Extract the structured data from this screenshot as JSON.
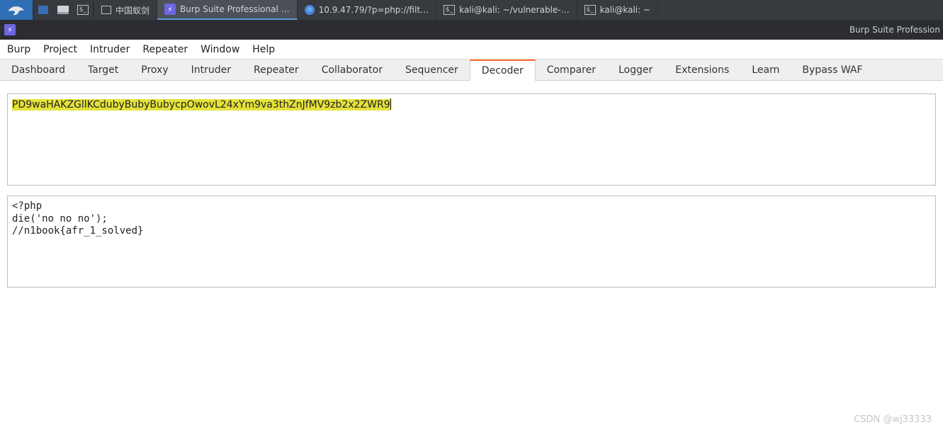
{
  "taskbar": {
    "items": [
      {
        "icon": "antsword",
        "label": "中国蚁剑"
      },
      {
        "icon": "burp",
        "label": "Burp Suite Professional …"
      },
      {
        "icon": "chromium",
        "label": "10.9.47.79/?p=php://filt…"
      },
      {
        "icon": "terminal",
        "label": "kali@kali: ~/vulnerable-…"
      },
      {
        "icon": "terminal",
        "label": "kali@kali: ~"
      }
    ]
  },
  "titlebar": {
    "title": "Burp Suite Profession"
  },
  "menu": [
    "Burp",
    "Project",
    "Intruder",
    "Repeater",
    "Window",
    "Help"
  ],
  "tabs": [
    "Dashboard",
    "Target",
    "Proxy",
    "Intruder",
    "Repeater",
    "Collaborator",
    "Sequencer",
    "Decoder",
    "Comparer",
    "Logger",
    "Extensions",
    "Learn",
    "Bypass WAF"
  ],
  "active_tab_index": 7,
  "decoder": {
    "input": "PD9waHAKZGllKCdubyBubyBubycpOwovL24xYm9va3thZnJfMV9zb2x2ZWR9",
    "output": "<?php\ndie('no no no');\n//n1book{afr_1_solved}"
  },
  "watermark": "CSDN @wj33333"
}
